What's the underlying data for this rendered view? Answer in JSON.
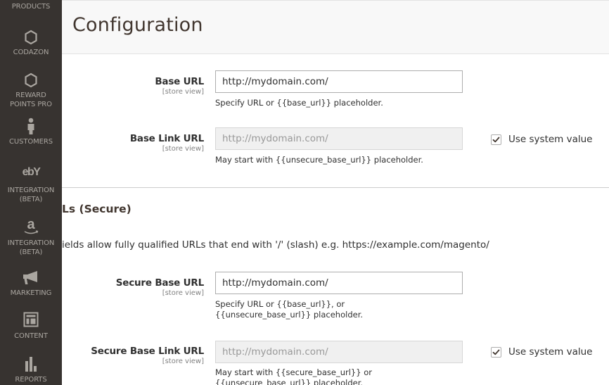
{
  "sidebar": {
    "items": [
      {
        "label": "PRODUCTS",
        "icon": "products-icon"
      },
      {
        "label": "CODAZON",
        "icon": "hexagon-icon"
      },
      {
        "label_lines": [
          "REWARD",
          "POINTS PRO"
        ],
        "icon": "hexagon-icon"
      },
      {
        "label": "CUSTOMERS",
        "icon": "person-icon"
      },
      {
        "label_lines": [
          "INTEGRATION",
          "(BETA)"
        ],
        "icon": "ebay-icon",
        "icon_text": "ebY"
      },
      {
        "label_lines": [
          "INTEGRATION",
          "(BETA)"
        ],
        "icon": "amazon-icon",
        "icon_text": "a"
      },
      {
        "label": "MARKETING",
        "icon": "megaphone-icon"
      },
      {
        "label": "CONTENT",
        "icon": "layout-icon"
      },
      {
        "label": "REPORTS",
        "icon": "bar-chart-icon"
      }
    ]
  },
  "header": {
    "title": "Configuration"
  },
  "unsecure": {
    "base_url": {
      "label": "Base URL",
      "scope": "[store view]",
      "value": "http://mydomain.com/",
      "note": "Specify URL or {{base_url}} placeholder."
    },
    "base_link_url": {
      "label": "Base Link URL",
      "scope": "[store view]",
      "value": "http://mydomain.com/",
      "disabled": true,
      "note": "May start with {{unsecure_base_url}} placeholder.",
      "use_system_value": {
        "label": "Use system value",
        "checked": true
      }
    }
  },
  "secure": {
    "section_title": "Base URLs (Secure)",
    "section_title_visible": "Ls (Secure)",
    "comment": "Any of the fields allow fully qualified URLs that end with '/' (slash) e.g. https://example.com/magento/",
    "comment_visible": "ields allow fully qualified URLs that end with '/' (slash) e.g. https://example.com/magento/",
    "secure_base_url": {
      "label": "Secure Base URL",
      "scope": "[store view]",
      "value": "http://mydomain.com/",
      "note": "Specify URL or {{base_url}}, or {{unsecure_base_url}} placeholder."
    },
    "secure_base_link_url": {
      "label": "Secure Base Link URL",
      "scope": "[store view]",
      "value": "http://mydomain.com/",
      "disabled": true,
      "note": "May start with {{secure_base_url}} or {{unsecure_base_url}} placeholder.",
      "use_system_value": {
        "label": "Use system value",
        "checked": true
      }
    }
  },
  "colors": {
    "sidebar_bg": "#373330",
    "sidebar_text": "#aaa6a0",
    "header_bg": "#f8f8f8",
    "title_text": "#41362f",
    "checkmark": "#1979c3"
  }
}
